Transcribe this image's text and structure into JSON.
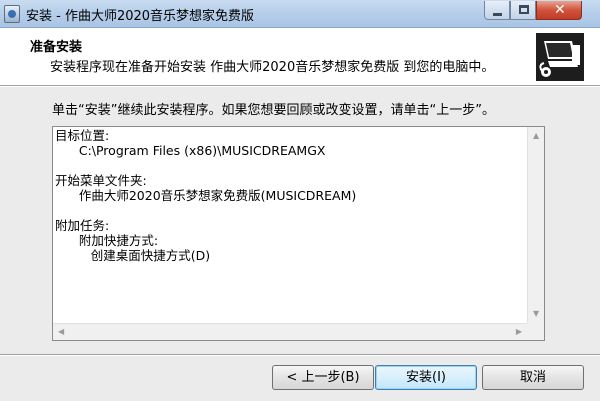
{
  "window": {
    "title": "安装 - 作曲大师2020音乐梦想家免费版",
    "close_glyph": "✕"
  },
  "header": {
    "title": "准备安装",
    "description": "安装程序现在准备开始安装 作曲大师2020音乐梦想家免费版 到您的电脑中。",
    "icon": "computer-setup-icon"
  },
  "body": {
    "instruction": "单击“安装”继续此安装程序。如果您想要回顾或改变设置，请单击“上一步”。",
    "memo_lines": [
      "目标位置:",
      "      C:\\Program Files (x86)\\MUSICDREAMGX",
      "",
      "开始菜单文件夹:",
      "      作曲大师2020音乐梦想家免费版(MUSICDREAM)",
      "",
      "附加任务:",
      "      附加快捷方式:",
      "         创建桌面快捷方式(D)"
    ]
  },
  "buttons": {
    "back": "< 上一步(B)",
    "install": "安装(I)",
    "cancel": "取消"
  }
}
